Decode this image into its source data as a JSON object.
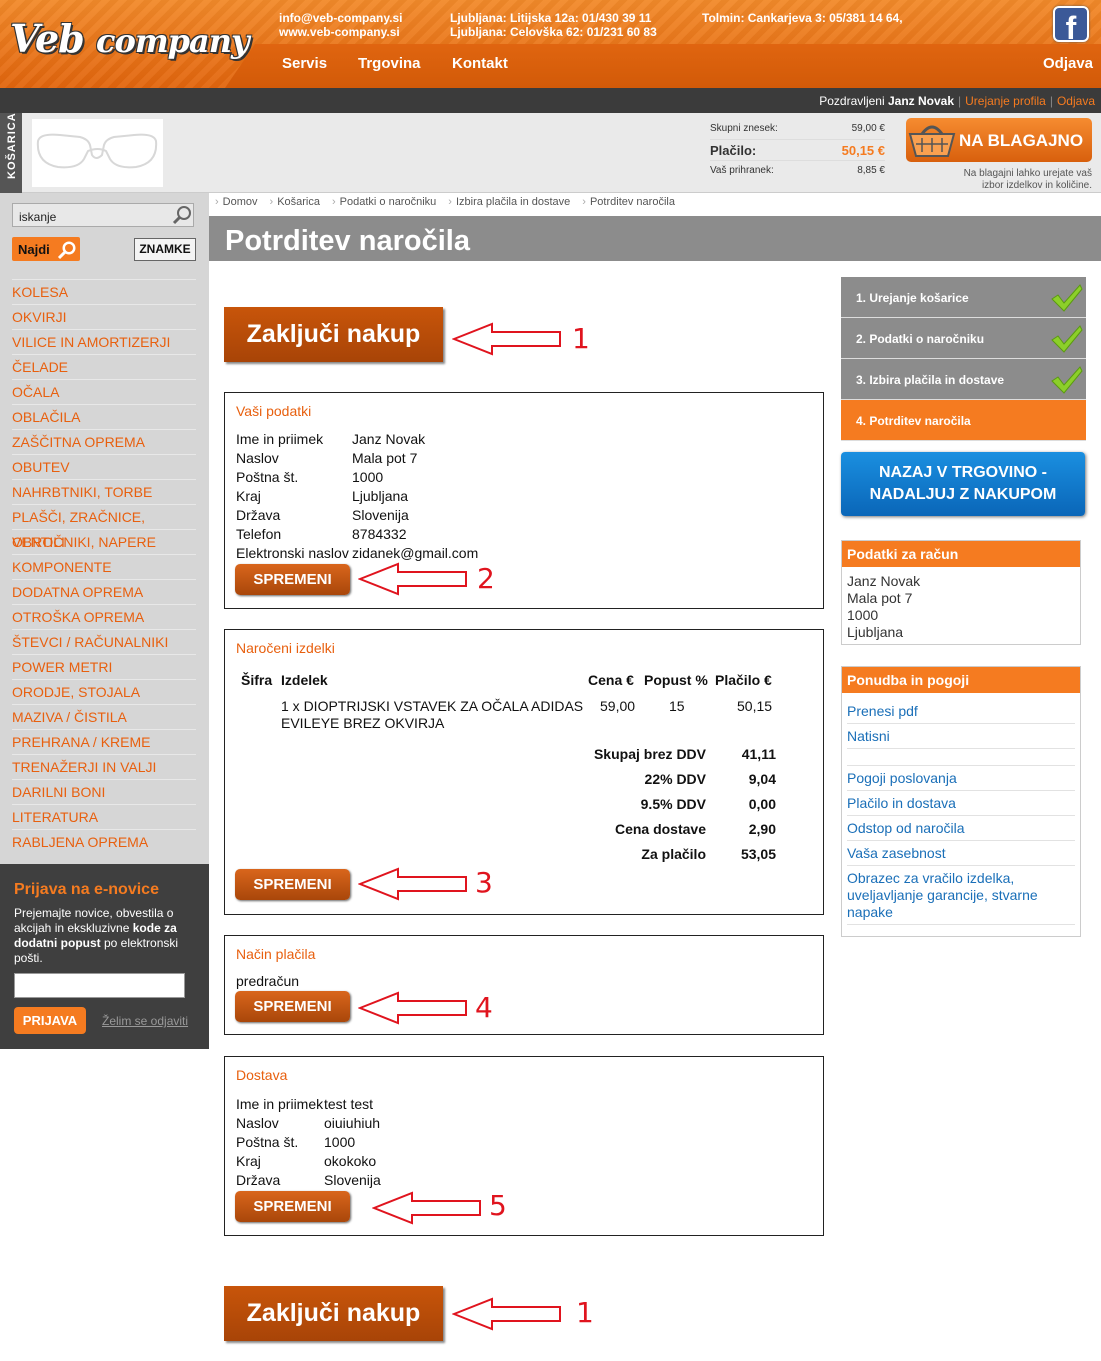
{
  "header": {
    "logo_main": "Veb",
    "logo_second": "company",
    "email": "info@veb-company.si",
    "website": "www.veb-company.si",
    "ljubljana_1": "Ljubljana: Litijska 12a: 01/430 39 11",
    "ljubljana_2": "Ljubljana: Celovška 62: 01/231 60 83",
    "tolmin": "Tolmin: Cankarjeva 3: 05/381 14 64,",
    "nav": [
      "Servis",
      "Trgovina",
      "Kontakt"
    ],
    "logout": "Odjava",
    "facebook_letter": "f"
  },
  "userbar": {
    "greeting": "Pozdravljeni",
    "user": "Janz Novak",
    "edit_profile": "Urejanje profila",
    "logout": "Odjava"
  },
  "cart": {
    "tab_label": "KOŠARICA",
    "total_label": "Skupni znesek:",
    "total_value": "59,00 €",
    "pay_label": "Plačilo:",
    "pay_value": "50,15 €",
    "savings_label": "Vaš prihranek:",
    "savings_value": "8,85 €",
    "checkout_label": "NA BLAGAJNO",
    "checkout_note": "Na blagajni lahko urejate vaš izbor izdelkov in količine."
  },
  "sidebar": {
    "search_value": "iskanje",
    "search_button": "Najdi",
    "brands_button": "ZNAMKE",
    "categories": [
      "KOLESA",
      "OKVIRJI",
      "VILICE IN AMORTIZERJI",
      "ČELADE",
      "OČALA",
      "OBLAČILA",
      "ZAŠČITNA OPREMA",
      "OBUTEV",
      "NAHRBTNIKI, TORBE",
      "PLAŠČI, ZRAČNICE, VENTILI",
      "OBROČNIKI, NAPERE",
      "KOMPONENTE",
      "DODATNA OPREMA",
      "OTROŠKA OPREMA",
      "ŠTEVCI / RAČUNALNIKI",
      "POWER METRI",
      "ORODJE, STOJALA",
      "MAZIVA / ČISTILA",
      "PREHRANA / KREME",
      "TRENAŽERJI IN VALJI",
      "DARILNI BONI",
      "LITERATURA",
      "RABLJENA OPREMA"
    ]
  },
  "newsletter": {
    "title": "Prijava na e-novice",
    "text_1": "Prejemajte novice, obvestila o akcijah in ekskluzivne ",
    "text_bold_1": "kode za dodatni popust",
    "text_2": " po elektronski pošti.",
    "button": "PRIJAVA",
    "unsubscribe": "Želim se odjaviti"
  },
  "breadcrumb": [
    "Domov",
    "Košarica",
    "Podatki o naročniku",
    "Izbira plačila in dostave",
    "Potrditev naročila"
  ],
  "page_title": "Potrditev naročila",
  "finish_button": "Zaključi nakup",
  "change_button": "SPREMENI",
  "annotations": [
    "1",
    "2",
    "3",
    "4",
    "5",
    "1"
  ],
  "customer": {
    "title": "Vaši podatki",
    "rows": [
      {
        "k": "Ime in priimek",
        "v": "Janz Novak"
      },
      {
        "k": "Naslov",
        "v": "Mala pot 7"
      },
      {
        "k": "Poštna št.",
        "v": "1000"
      },
      {
        "k": "Kraj",
        "v": "Ljubljana"
      },
      {
        "k": "Država",
        "v": "Slovenija"
      },
      {
        "k": "Telefon",
        "v": "8784332"
      },
      {
        "k": "Elektronski naslov",
        "v": "zidanek@gmail.com"
      }
    ]
  },
  "order": {
    "title": "Naročeni izdelki",
    "headers": [
      "Šifra",
      "Izdelek",
      "Cena €",
      "Popust %",
      "Plačilo €"
    ],
    "item": {
      "name_1": "1 x DIOPTRIJSKI VSTAVEK ZA OČALA ADIDAS",
      "name_2": "EVILEYE BREZ OKVIRJA",
      "price": "59,00",
      "discount": "15",
      "pay": "50,15"
    },
    "sums": [
      {
        "l": "Skupaj brez DDV",
        "v": "41,11"
      },
      {
        "l": "22% DDV",
        "v": "9,04"
      },
      {
        "l": "9.5% DDV",
        "v": "0,00"
      },
      {
        "l": "Cena dostave",
        "v": "2,90"
      },
      {
        "l": "Za plačilo",
        "v": "53,05"
      }
    ]
  },
  "payment": {
    "title": "Način plačila",
    "value": "predračun"
  },
  "delivery": {
    "title": "Dostava",
    "rows": [
      {
        "k": "Ime in priimek",
        "v": "test test"
      },
      {
        "k": "Naslov",
        "v": "oiuiuhiuh"
      },
      {
        "k": "Poštna št.",
        "v": "1000"
      },
      {
        "k": "Kraj",
        "v": "okokoko"
      },
      {
        "k": "Država",
        "v": "Slovenija"
      }
    ]
  },
  "steps": [
    {
      "label": "1. Urejanje košarice",
      "done": true
    },
    {
      "label": "2. Podatki o naročniku",
      "done": true
    },
    {
      "label": "3. Izbira plačila in dostave",
      "done": true
    },
    {
      "label": "4. Potrditev naročila",
      "done": false
    }
  ],
  "back_button_1": "NAZAJ V TRGOVINO -",
  "back_button_2": "NADALJUJ Z NAKUPOM",
  "billing": {
    "title": "Podatki za račun",
    "lines": [
      "Janz Novak",
      "Mala pot 7",
      "1000",
      "Ljubljana"
    ]
  },
  "offer": {
    "title": "Ponudba in pogoji",
    "links_top": [
      "Prenesi pdf",
      "Natisni"
    ],
    "links_bottom": [
      "Pogoji poslovanja",
      "Plačilo in dostava",
      "Odstop od naročila",
      "Vaša zasebnost",
      "Obrazec za vračilo izdelka, uveljavljanje garancije, stvarne napake"
    ]
  },
  "colors": {
    "accent": "#f57b20",
    "dark": "#3b3b3b",
    "link": "#1a6fb8",
    "annotation": "#e0141e"
  }
}
